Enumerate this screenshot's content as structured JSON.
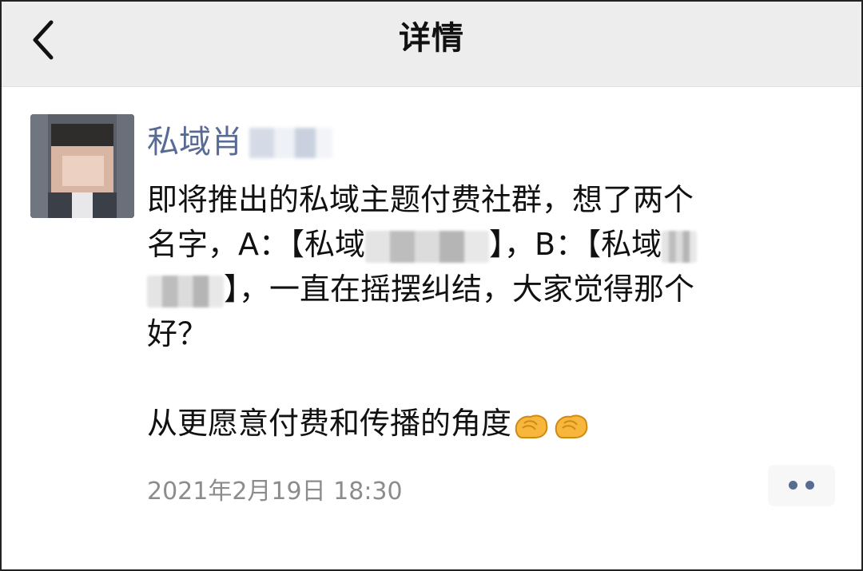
{
  "nav": {
    "title": "详情",
    "back_icon": "chevron-left-icon"
  },
  "post": {
    "author": "私域肖",
    "lines": {
      "l1": "即将推出的私域主题付费社群，想了两个",
      "l2a": "名字，A：【私域",
      "l2b": "】，B：【私域",
      "l3": "】，一直在摇摆纠结，大家觉得那个",
      "l4": "好？",
      "l5": "从更愿意付费和传播的角度"
    },
    "emoji": [
      "clap-hands-emoji",
      "clap-hands-emoji"
    ],
    "timestamp": "2021年2月19日 18:30"
  },
  "actions": {
    "more_icon": "more-dots-icon"
  },
  "colors": {
    "nav_bg": "#ededed",
    "link_blue": "#576b95",
    "text": "#111111",
    "meta_gray": "#8c8c8c"
  }
}
